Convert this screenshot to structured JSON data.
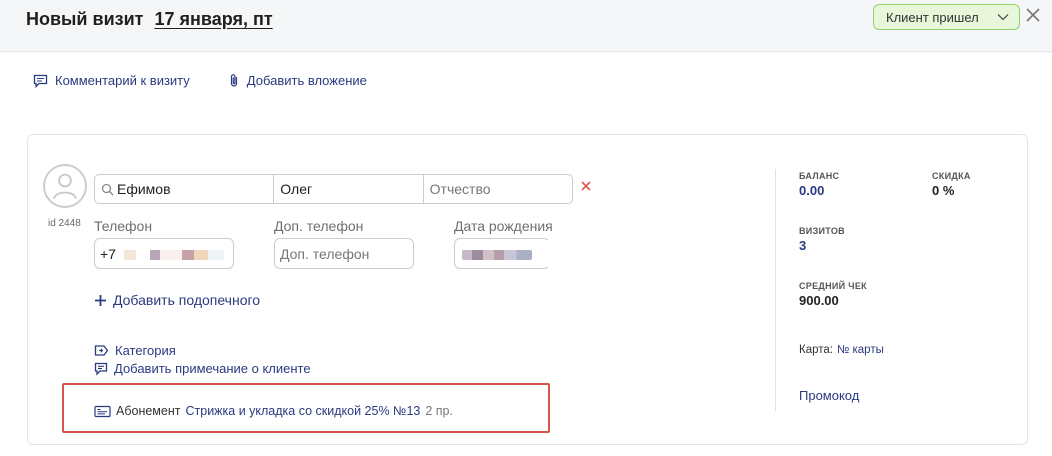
{
  "header": {
    "title": "Новый визит",
    "date": "17 января, пт",
    "status_label": "Клиент пришел"
  },
  "actions": {
    "comment_label": "Комментарий к визиту",
    "attach_label": "Добавить вложение"
  },
  "client": {
    "id_label": "id 2448",
    "last_name": "Ефимов",
    "first_name": "Олег",
    "middle_name_placeholder": "Отчество",
    "phone_label": "Телефон",
    "phone_prefix": "+7",
    "extra_phone_label": "Доп. телефон",
    "extra_phone_placeholder": "Доп. телефон",
    "birthdate_label": "Дата рождения",
    "add_ward_label": "Добавить подопечного",
    "category_label": "Категория",
    "add_note_label": "Добавить примечание о клиенте"
  },
  "subscription": {
    "prefix": "Абонемент",
    "name": "Стрижка и укладка со скидкой 25% №13",
    "count": "2 пр."
  },
  "stats": {
    "balance_label": "БАЛАНС",
    "balance_value": "0.00",
    "discount_label": "СКИДКА",
    "discount_value": "0 %",
    "visits_label": "ВИЗИТОВ",
    "visits_value": "3",
    "avg_check_label": "СРЕДНИЙ ЧЕК",
    "avg_check_value": "900.00",
    "card_label": "Карта:",
    "card_link": "№ карты",
    "promo_label": "Промокод"
  },
  "colors": {
    "accent": "#2a3a80",
    "status_bg": "#e8f6d9",
    "status_border": "#8fd36a",
    "highlight": "#d9534f"
  }
}
